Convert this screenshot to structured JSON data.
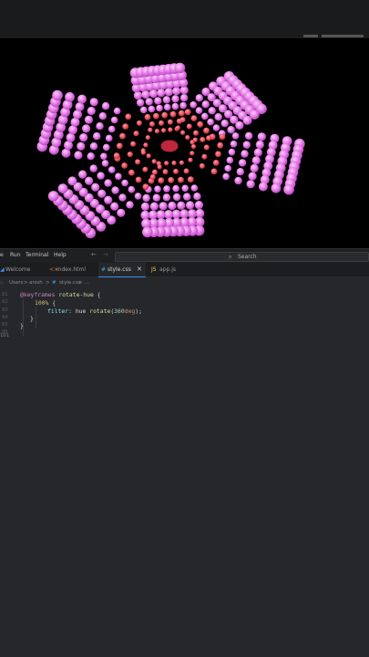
{
  "menu": {
    "items": [
      "Run",
      "Terminal",
      "Help"
    ],
    "search_label": "Search",
    "back": "←",
    "forward": "→",
    "search_icon": "magnifier-icon"
  },
  "tabs": [
    {
      "label": "Welcome",
      "icon": "vscode-icon",
      "active": false
    },
    {
      "label": "index.html",
      "icon": "html-icon",
      "active": false
    },
    {
      "label": "style.css",
      "icon": "css-hash-icon",
      "active": true
    },
    {
      "label": "app.js",
      "icon": "js-icon",
      "active": false
    }
  ],
  "breadcrumb": {
    "parts": [
      "Users",
      "anish",
      "style.css",
      "..."
    ]
  },
  "code": {
    "line_numbers": [
      "81",
      "82",
      "83",
      "84",
      "85",
      "86",
      "100",
      "101"
    ],
    "keyframes_kw": "@keyframes",
    "keyframes_name": "rotate-hue",
    "open_brace": "{",
    "selector": "100%",
    "prop": "filter",
    "colon": ":",
    "value_fn": "hue",
    "value_call": "rotate",
    "value_num": "360",
    "value_unit": "deg",
    "value_tail": ");",
    "close_brace": "}"
  },
  "colors": {
    "accent": "#3b8eea",
    "editor_bg": "#25272a",
    "petal_pink": "#e56ad8",
    "petal_red": "#e03a52"
  }
}
